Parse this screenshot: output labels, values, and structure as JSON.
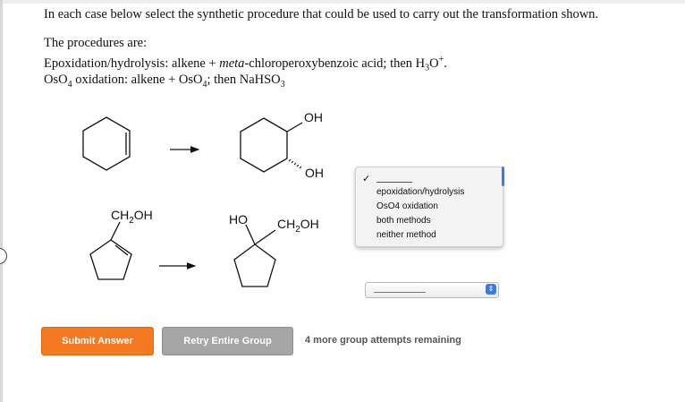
{
  "intro": "In each case below select the synthetic procedure that could be used to carry out the transformation shown.",
  "procedures": {
    "heading": "The procedures are:",
    "p1_prefix": "Epoxidation/hydrolysis: alkene + ",
    "p1_italic": "meta",
    "p1_mid": "-chloroperoxybenzoic acid; then H",
    "p1_sub": "3",
    "p1_o": "O",
    "p1_sup": "+",
    "p1_end": ".",
    "p2_a": "OsO",
    "p2_sub1": "4",
    "p2_b": " oxidation: alkene + OsO",
    "p2_sub2": "4",
    "p2_c": "; then NaHSO",
    "p2_sub3": "3"
  },
  "reaction1": {
    "label_oh_top": "OH",
    "label_oh_bottom": "OH"
  },
  "reaction2": {
    "start_label": "CH",
    "start_sub": "2",
    "start_end": "OH",
    "prod_ho": "HO",
    "prod_label": "CH",
    "prod_sub": "2",
    "prod_end": "OH"
  },
  "dropdown": {
    "checkmark": "✓",
    "options": [
      "epoxidation/hydrolysis",
      "OsO4 oxidation",
      "both methods",
      "neither method"
    ]
  },
  "buttons": {
    "submit": "Submit Answer",
    "retry": "Retry Entire Group"
  },
  "attempts": "4 more group attempts remaining"
}
